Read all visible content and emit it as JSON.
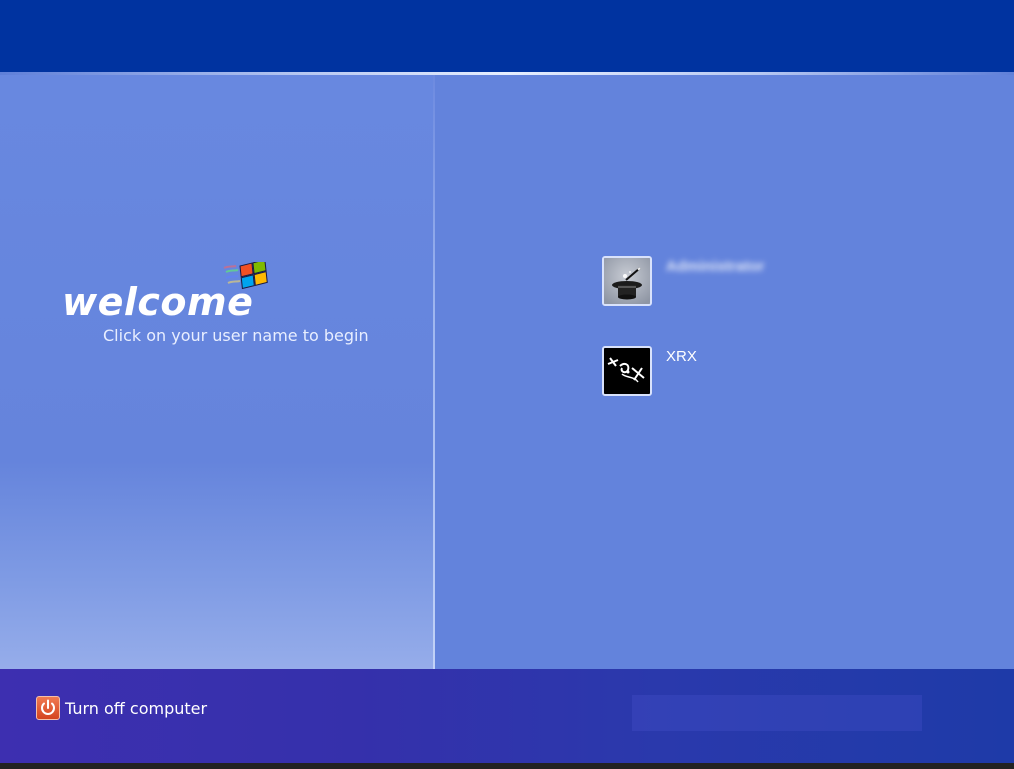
{
  "welcome": {
    "title": "welcome",
    "subtitle": "Click on your user name to begin",
    "logo_icon": "windows-flag-icon"
  },
  "users": [
    {
      "name": "Administrator",
      "name_obscured": true,
      "picture_icon": "magic-hat-icon"
    },
    {
      "name": "XRX",
      "name_obscured": false,
      "picture_icon": "xrx-avatar-icon"
    }
  ],
  "footer": {
    "turn_off_label": "Turn off computer",
    "turn_off_icon": "power-icon"
  },
  "colors": {
    "top_band": "#0033a0",
    "main": "#6383dc",
    "footer": "#3530ab",
    "power_button": "#e0532c"
  }
}
